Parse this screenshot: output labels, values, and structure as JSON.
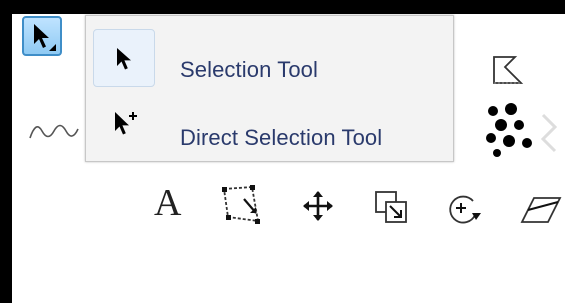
{
  "flyout": {
    "items": [
      {
        "label": "Selection Tool",
        "icon": "selection-arrow-icon"
      },
      {
        "label": "Direct Selection Tool",
        "icon": "direct-selection-arrow-icon"
      }
    ]
  },
  "toolbar": {
    "type_tool_glyph": "A",
    "tools": [
      "selection-tool-icon",
      "wave-curve-icon",
      "lasso-polygon-icon",
      "halftone-pattern-icon",
      "type-tool-icon",
      "free-transform-icon",
      "move-crosshair-icon",
      "resize-box-icon",
      "rotate-zoom-icon",
      "shear-icon"
    ]
  },
  "colors": {
    "accent_blue": "#8fcaf3",
    "accent_border": "#3f8ec8",
    "label_color": "#2a3a6c"
  }
}
